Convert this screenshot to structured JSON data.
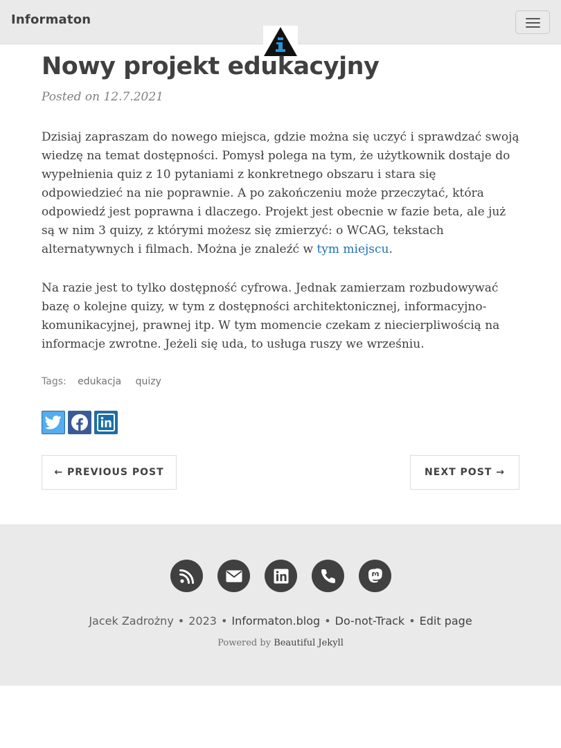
{
  "navbar": {
    "brand": "Informaton",
    "logo_icon": "informaton-logo-icon",
    "menu_icon": "hamburger-menu-icon"
  },
  "post": {
    "title": "Nowy projekt edukacyjny",
    "meta": "Posted on 12.7.2021",
    "para1_text": "Dzisiaj zapraszam do nowego miejsca, gdzie można się uczyć i sprawdzać swoją wiedzę na temat dostępności. Pomysł polega na tym, że użytkownik dostaje do wypełnienia quiz z 10 pytaniami z konkretnego obszaru i stara się odpowiedzieć na nie poprawnie. A po zakończeniu może przeczytać, która odpowiedź jest poprawna i dlaczego. Projekt jest obecnie w fazie beta, ale już są w nim 3 quizy, z którymi możesz się zmierzyć: o WCAG, tekstach alternatywnych i filmach. Można je znaleźć w ",
    "para1_link": "tym miejscu",
    "para1_end": ".",
    "para2": "Na razie jest to tylko dostępność cyfrowa. Jednak zamierzam rozbudowywać bazę o kolejne quizy, w tym z dostępności architektonicznej, informacyjno-komunikacyjnej, prawnej itp. W tym momencie czekam z niecierpliwością na informacje zwrotne. Jeżeli się uda, to usługa ruszy we wrześniu."
  },
  "tags": {
    "label": "Tags:",
    "items": [
      "edukacja",
      "quizy"
    ]
  },
  "share": {
    "icons": [
      "twitter-icon",
      "facebook-icon",
      "linkedin-icon"
    ],
    "colors": {
      "twitter": "#55acee",
      "facebook": "#3b5998",
      "linkedin": "#1a6fa6"
    }
  },
  "pager": {
    "prev": "← PREVIOUS POST",
    "next": "NEXT POST →"
  },
  "footer": {
    "social_icons": [
      "rss-icon",
      "envelope-icon",
      "linkedin-icon",
      "phone-icon",
      "mastodon-icon"
    ],
    "author": "Jacek Zadrożny",
    "year": "2023",
    "site": "Informaton.blog",
    "dnt": "Do-not-Track",
    "edit": "Edit page",
    "separator": "•",
    "powered_prefix": "Powered by",
    "powered_link": "Beautiful Jekyll"
  },
  "colors": {
    "navbar_bg": "#eaeaea",
    "text": "#404040",
    "link": "#1f6fb5",
    "footer_icon_bg": "#404040"
  }
}
